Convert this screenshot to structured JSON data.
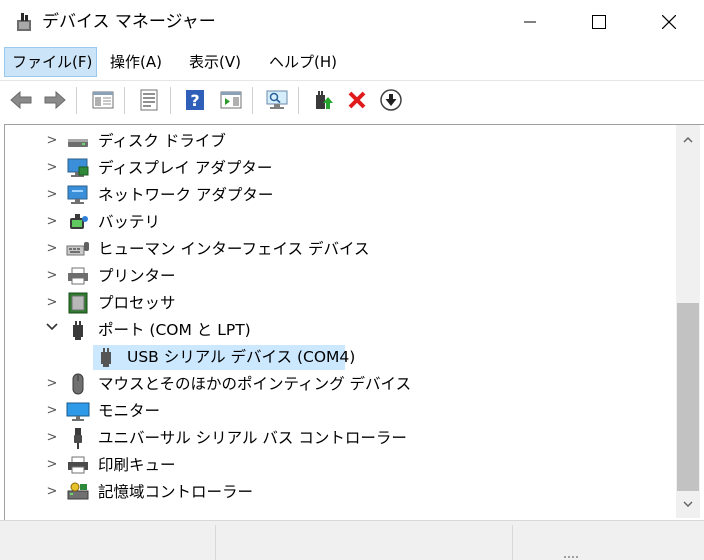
{
  "window": {
    "title": "デバイス マネージャー"
  },
  "menu": [
    {
      "label": "ファイル(F)"
    },
    {
      "label": "操作(A)"
    },
    {
      "label": "表示(V)"
    },
    {
      "label": "ヘルプ(H)"
    }
  ],
  "toolbar": {
    "icons": [
      "back-arrow-icon",
      "forward-arrow-icon",
      "show-hide-console-tree-icon",
      "properties-icon",
      "help-icon",
      "action-pane-icon",
      "scan-hardware-icon",
      "update-driver-icon",
      "uninstall-device-icon",
      "disable-device-icon"
    ]
  },
  "tree": {
    "items": [
      {
        "label": "ディスク ドライブ",
        "icon": "disk-drive-icon",
        "expanded": false
      },
      {
        "label": "ディスプレイ アダプター",
        "icon": "display-adapter-icon",
        "expanded": false
      },
      {
        "label": "ネットワーク アダプター",
        "icon": "network-adapter-icon",
        "expanded": false
      },
      {
        "label": "バッテリ",
        "icon": "battery-icon",
        "expanded": false
      },
      {
        "label": "ヒューマン インターフェイス デバイス",
        "icon": "human-interface-device-icon",
        "expanded": false
      },
      {
        "label": "プリンター",
        "icon": "printer-icon",
        "expanded": false
      },
      {
        "label": "プロセッサ",
        "icon": "processor-icon",
        "expanded": false
      },
      {
        "label": "ポート (COM と LPT)",
        "icon": "port-icon",
        "expanded": true
      },
      {
        "label": "USB シリアル デバイス (COM4)",
        "icon": "usb-serial-port-icon",
        "child": true,
        "selected": true
      },
      {
        "label": "マウスとそのほかのポインティング デバイス",
        "icon": "mouse-icon",
        "expanded": false
      },
      {
        "label": "モニター",
        "icon": "monitor-icon",
        "expanded": false
      },
      {
        "label": "ユニバーサル シリアル バス コントローラー",
        "icon": "usb-controller-icon",
        "expanded": false
      },
      {
        "label": "印刷キュー",
        "icon": "print-queue-icon",
        "expanded": false
      },
      {
        "label": "記憶域コントローラー",
        "icon": "storage-controller-icon",
        "expanded": false
      }
    ]
  },
  "colors": {
    "selection": "#cce8ff",
    "menu_active": "#cce4f7",
    "scroll_thumb": "#c2c2c2"
  }
}
